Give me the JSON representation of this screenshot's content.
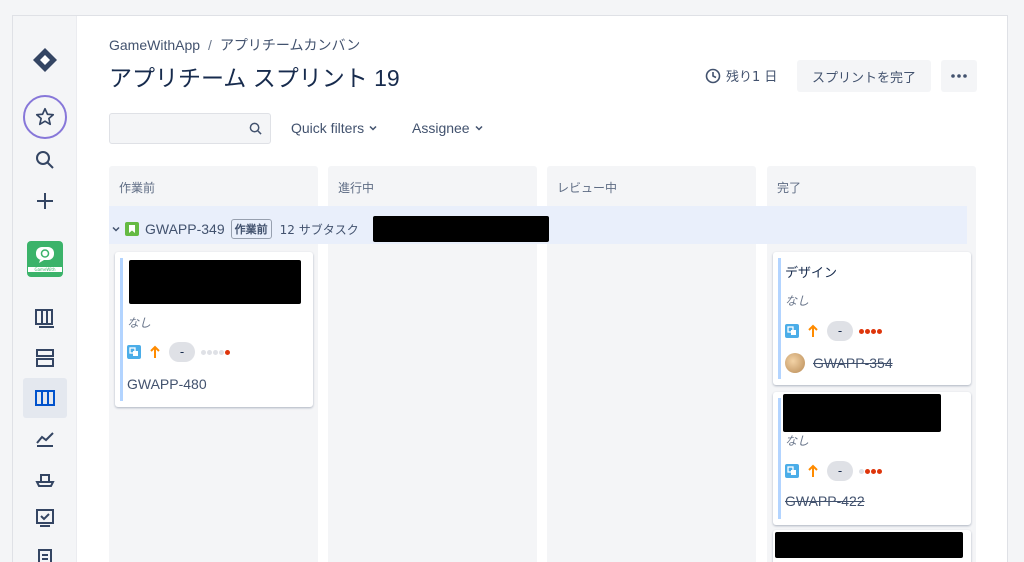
{
  "breadcrumb": {
    "project": "GameWithApp",
    "separator": "/",
    "board": "アプリチームカンバン"
  },
  "page": {
    "title": "アプリチーム スプリント 19"
  },
  "header": {
    "remaining": "残り1 日",
    "complete_button": "スプリントを完了"
  },
  "filters": {
    "search_placeholder": "",
    "quick_filters": "Quick filters",
    "assignee": "Assignee"
  },
  "app_logo_caption": "GameWith",
  "columns": [
    {
      "name": "作業前"
    },
    {
      "name": "進行中"
    },
    {
      "name": "レビュー中"
    },
    {
      "name": "完了"
    }
  ],
  "swimlane": {
    "key": "GWAPP-349",
    "status": "作業前",
    "subtasks": "12 サブタスク"
  },
  "cards": [
    {
      "title": "",
      "epic": "なし",
      "estimate": "-",
      "key": "GWAPP-480"
    },
    {
      "title": "デザイン",
      "epic": "なし",
      "estimate": "-",
      "key": "GWAPP-354"
    },
    {
      "title": "",
      "epic": "なし",
      "estimate": "-",
      "key": "GWAPP-422"
    }
  ],
  "colors": {
    "accent": "#0052cc",
    "star_ring": "#8777d9",
    "priority": "#ff8b00",
    "story": "#65ba43",
    "subtask": "#4bade8",
    "dot_red": "#de350b"
  }
}
